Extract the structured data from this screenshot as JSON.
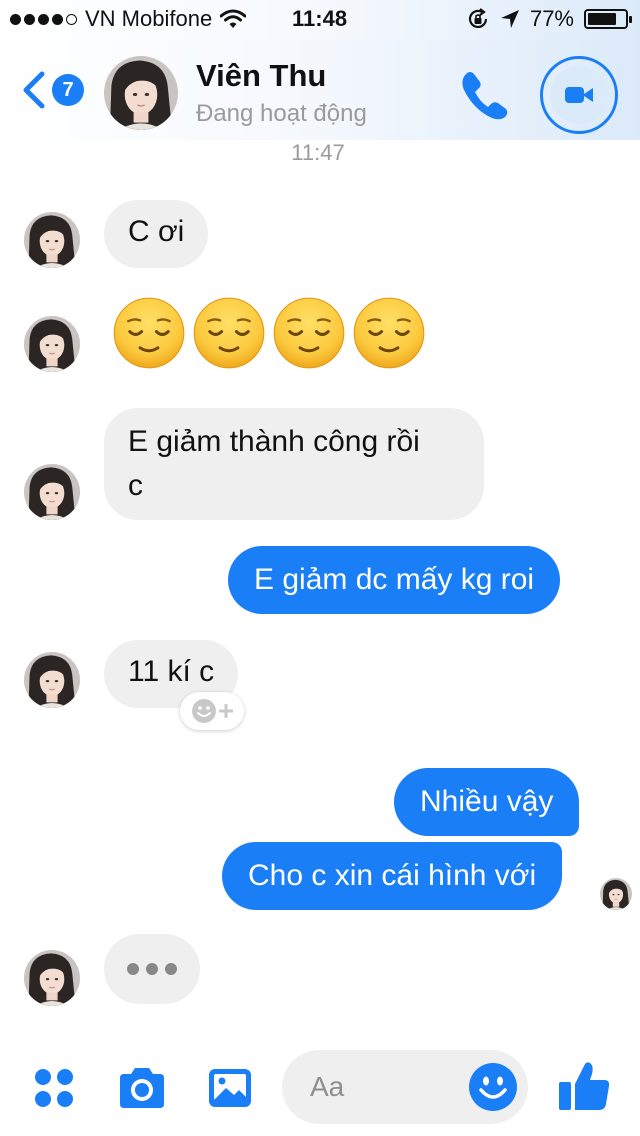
{
  "status_bar": {
    "carrier": "VN Mobifone",
    "time": "11:48",
    "battery_percent": "77%",
    "battery_level": 0.77
  },
  "header": {
    "back_badge_count": "7",
    "contact_name": "Viên Thu",
    "contact_status": "Đang hoạt động",
    "call_icon": "phone-icon",
    "video_icon": "video-camera-icon"
  },
  "timestamp": "11:47",
  "messages": [
    {
      "direction": "incoming",
      "text": "C ơi"
    },
    {
      "direction": "incoming",
      "type": "emoji",
      "emoji": "relieved-face",
      "count": 4
    },
    {
      "direction": "incoming",
      "text_line1": "E giảm thành công rồi",
      "text_line2": "c"
    },
    {
      "direction": "outgoing",
      "text": "E giảm dc mấy kg roi"
    },
    {
      "direction": "incoming",
      "text": "11 kí c"
    },
    {
      "direction": "outgoing",
      "text": "Nhiều vậy"
    },
    {
      "direction": "outgoing",
      "text": "Cho c xin cái hình với"
    }
  ],
  "composer": {
    "placeholder": "Aa",
    "icons": [
      "apps-icon",
      "camera-icon",
      "photo-icon",
      "emoji-icon",
      "like-icon"
    ]
  },
  "colors": {
    "accent": "#1a7ef6",
    "incoming_bubble": "#efefef",
    "muted_text": "#9a9a9a"
  }
}
